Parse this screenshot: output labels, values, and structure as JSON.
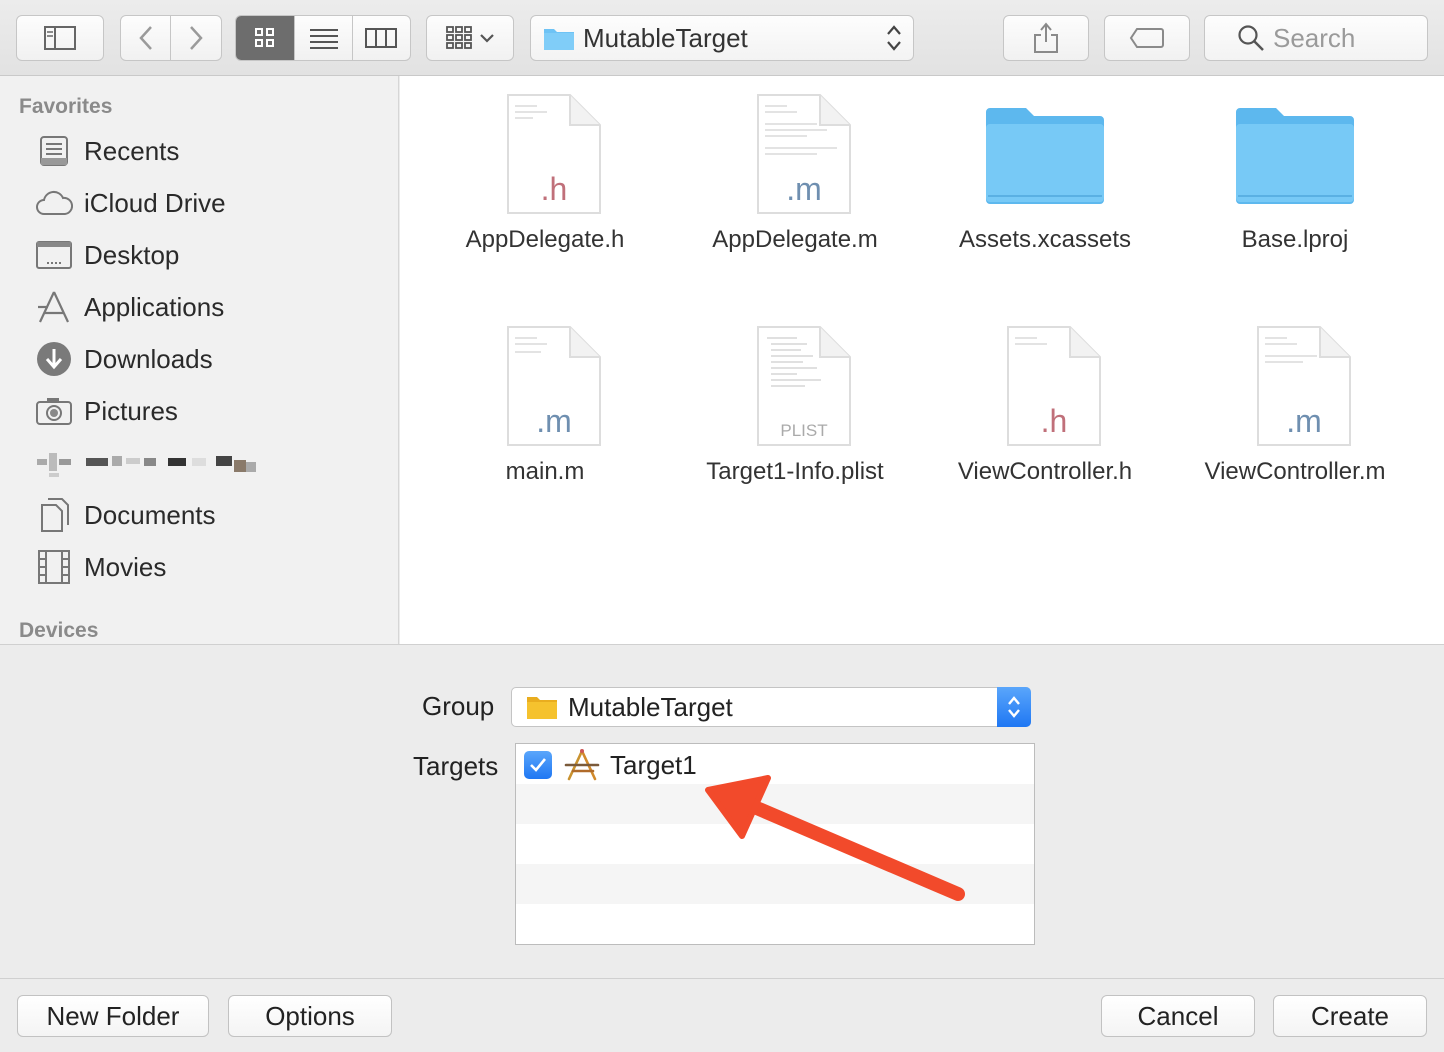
{
  "colors": {
    "accent": "#2f86f6",
    "folder_blue": "#6ec3f5",
    "folder_yellow": "#f5c22e",
    "annotation_arrow": "#f24a2b"
  },
  "toolbar": {
    "sidebar_toggle_icon": "sidebar-icon",
    "back_icon": "chevron-left-icon",
    "forward_icon": "chevron-right-icon",
    "view_modes": [
      "icon-view",
      "list-view",
      "column-view"
    ],
    "active_view": "icon-view",
    "arrange_icon": "grid-arrange-icon",
    "path_label": "MutableTarget",
    "share_icon": "share-icon",
    "tag_icon": "tag-icon",
    "search_placeholder": "Search"
  },
  "sidebar": {
    "favorites_header": "Favorites",
    "items": [
      {
        "label": "Recents",
        "icon": "recents-icon"
      },
      {
        "label": "iCloud Drive",
        "icon": "cloud-icon"
      },
      {
        "label": "Desktop",
        "icon": "desktop-icon"
      },
      {
        "label": "Applications",
        "icon": "applications-icon"
      },
      {
        "label": "Downloads",
        "icon": "download-icon"
      },
      {
        "label": "Pictures",
        "icon": "camera-icon"
      },
      {
        "label": "",
        "icon": "redacted-icon"
      },
      {
        "label": "Documents",
        "icon": "documents-icon"
      },
      {
        "label": "Movies",
        "icon": "film-icon"
      }
    ],
    "devices_header": "Devices"
  },
  "files": [
    {
      "name": "AppDelegate.h",
      "kind": "doc",
      "ext": ".h"
    },
    {
      "name": "AppDelegate.m",
      "kind": "doc",
      "ext": ".m"
    },
    {
      "name": "Assets.xcassets",
      "kind": "folder",
      "ext": ""
    },
    {
      "name": "Base.lproj",
      "kind": "folder",
      "ext": ""
    },
    {
      "name": "main.m",
      "kind": "doc",
      "ext": ".m"
    },
    {
      "name": "Target1-Info.plist",
      "kind": "plist",
      "ext": "PLIST"
    },
    {
      "name": "ViewController.h",
      "kind": "doc",
      "ext": ".h"
    },
    {
      "name": "ViewController.m",
      "kind": "doc",
      "ext": ".m"
    }
  ],
  "options": {
    "group_label": "Group",
    "group_value": "MutableTarget",
    "targets_label": "Targets",
    "targets": [
      {
        "name": "Target1",
        "checked": true,
        "icon": "app-target-icon"
      }
    ]
  },
  "bottom": {
    "new_folder": "New Folder",
    "options": "Options",
    "cancel": "Cancel",
    "create": "Create"
  }
}
